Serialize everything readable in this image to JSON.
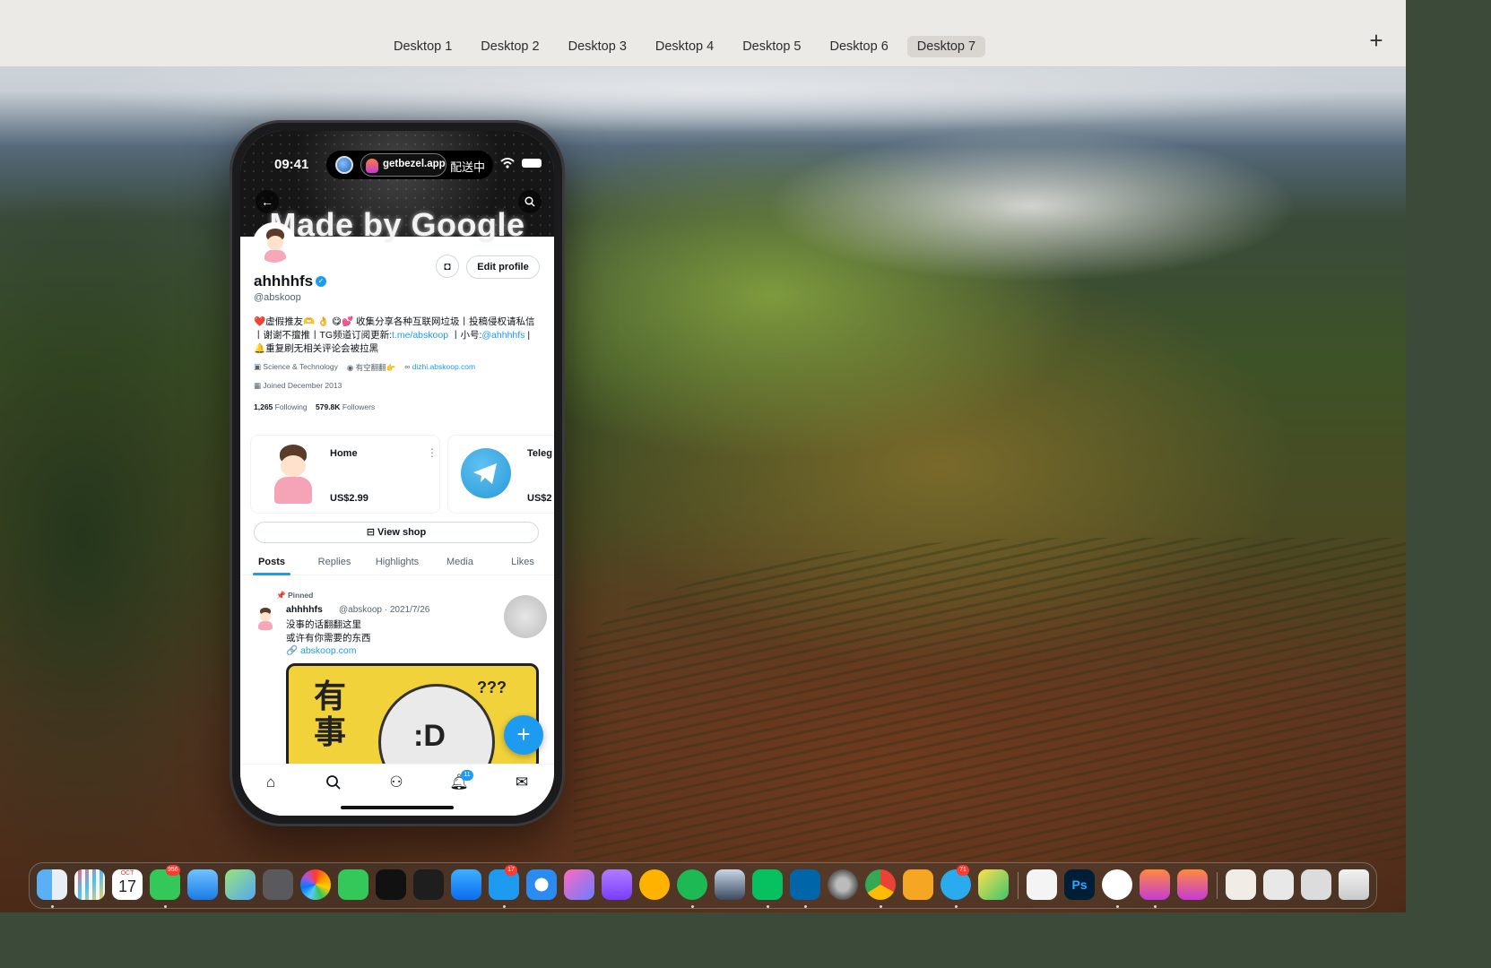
{
  "spaces": {
    "tabs": [
      "Desktop 1",
      "Desktop 2",
      "Desktop 3",
      "Desktop 4",
      "Desktop 5",
      "Desktop 6",
      "Desktop 7"
    ],
    "active_index": 6,
    "add_label": "+"
  },
  "phone": {
    "status_time": "09:41",
    "island_url": "getbezel.app",
    "island_status": "配送中",
    "banner_text": "Made by Google",
    "profile": {
      "display_name": "ahhhhfs",
      "handle": "@abskoop",
      "edit_profile_label": "Edit profile",
      "bio_part1": "❤️虚假推友🫶 👌 😋💕 收集分享各种互联网垃圾丨投稿侵权请私信丨谢谢不擅推丨TG频道订阅更新:",
      "bio_link1": "t.me/abskoop",
      "bio_part2": " 丨小号:",
      "bio_link2": "@ahhhhfs",
      "bio_part3": " | 🔔重复刷无相关评论会被拉黑",
      "category": "Science & Technology",
      "location": "有空翻翻👉",
      "website": "dizhi.abskoop.com",
      "joined": "Joined December 2013",
      "following_count": "1,265",
      "following_label": "Following",
      "followers_count": "579.8K",
      "followers_label": "Followers"
    },
    "shop": {
      "items": [
        {
          "title": "Home",
          "price": "US$2.99"
        },
        {
          "title": "Teleg",
          "price": "US$2"
        }
      ],
      "view_shop_label": "View shop"
    },
    "tabs": [
      "Posts",
      "Replies",
      "Highlights",
      "Media",
      "Likes"
    ],
    "active_tab": 0,
    "post": {
      "pinned_label": "Pinned",
      "author": "ahhhhfs",
      "meta": "@abskoop · 2021/7/26",
      "line1": "没事的话翻翻这里",
      "line2": "或许有你需要的东西",
      "link": "abskoop.com",
      "image_text": "有事",
      "image_face": ":D",
      "image_q": "???"
    },
    "fab_label": "+",
    "notifications_badge": "11",
    "icons": {
      "back": "arrow-left-icon",
      "search": "search-icon",
      "nav": [
        "home-icon",
        "search-icon",
        "communities-icon",
        "bell-icon",
        "mail-icon"
      ]
    }
  },
  "dock": {
    "calendar_month": "OCT",
    "calendar_day": "17",
    "messages_badge": "956",
    "twitter_badge": "17",
    "telegram_badge": "71",
    "ps_label": "Ps"
  }
}
